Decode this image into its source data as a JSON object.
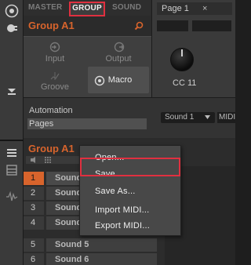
{
  "tabs": {
    "master": "MASTER",
    "group": "GROUP",
    "sound": "SOUND"
  },
  "group_title": "Group A1",
  "modes": {
    "input": "Input",
    "output": "Output",
    "groove": "Groove",
    "macro": "Macro"
  },
  "plugin": {
    "page_tab": "Page 1",
    "page_tab_close": "×",
    "knob_label": "CC 11"
  },
  "automation": {
    "label": "Automation",
    "pages_value": "Pages"
  },
  "routing": {
    "sound_dropdown": "Sound 1",
    "midi_dropdown": "MIDI"
  },
  "group_editor": {
    "title": "Group A1"
  },
  "sound_rows": [
    {
      "num": "1",
      "name": "Sound 1"
    },
    {
      "num": "2",
      "name": "Sound 2"
    },
    {
      "num": "3",
      "name": "Sound 3"
    },
    {
      "num": "4",
      "name": "Sound 4"
    },
    {
      "num": "5",
      "name": "Sound 5"
    },
    {
      "num": "6",
      "name": "Sound 6"
    }
  ],
  "context_menu": {
    "open": "Open...",
    "save": "Save",
    "save_as": "Save As...",
    "import_midi": "Import MIDI...",
    "export_midi": "Export MIDI..."
  },
  "colors": {
    "accent": "#e03040",
    "title_orange": "#d8642c",
    "row_selected": "#d8642c",
    "row_bg": "#4a4a4a"
  }
}
